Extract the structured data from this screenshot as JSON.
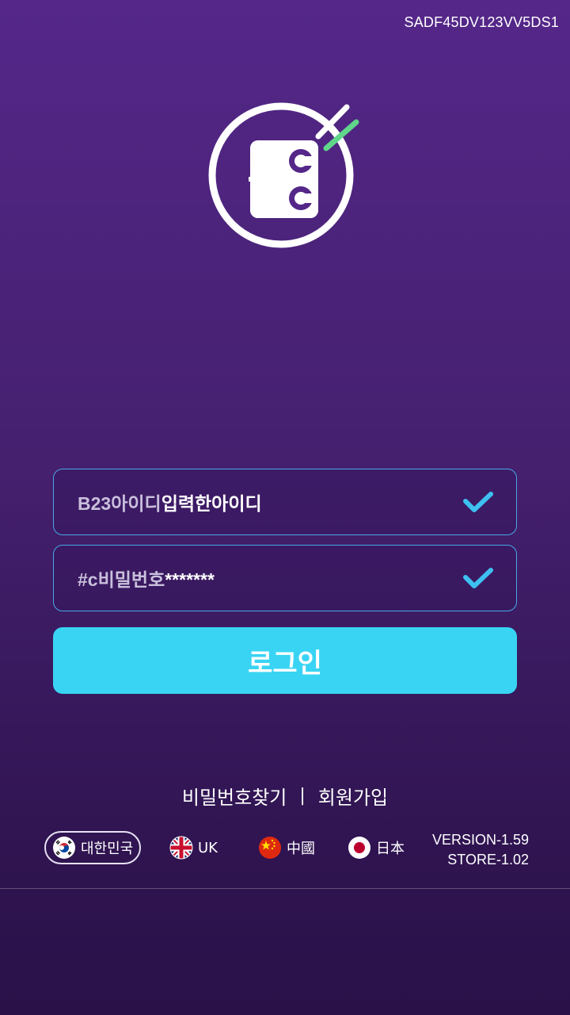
{
  "device_id": "SADF45DV123VV5DS1",
  "login": {
    "id_prefix": "B23아이디",
    "id_value": "입력한아이디",
    "pw_prefix": "#c비밀번호",
    "pw_value": "*******",
    "button_label": "로그인"
  },
  "links": {
    "find_password": "비밀번호찾기",
    "separator": "|",
    "signup": "회원가입"
  },
  "languages": [
    {
      "label": "대한민국",
      "flag": "korea-flag",
      "selected": true
    },
    {
      "label": "UK",
      "flag": "uk-flag",
      "selected": false
    },
    {
      "label": "中國",
      "flag": "china-flag",
      "selected": false
    },
    {
      "label": "日本",
      "flag": "japan-flag",
      "selected": false
    }
  ],
  "version": {
    "app": "VERSION-1.59",
    "store": "STORE-1.02"
  },
  "colors": {
    "accent": "#39d4f4",
    "field_border": "#47a9e6",
    "check": "#3ec0f0",
    "logo_green": "#5fd68a",
    "background_top": "#542789",
    "background_bottom": "#2a1148"
  }
}
